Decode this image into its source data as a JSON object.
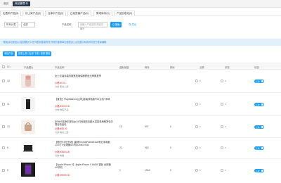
{
  "topbar": {
    "tabs": [
      {
        "label": "首页"
      },
      {
        "label": "商品管理 ⊗"
      }
    ]
  },
  "filter_tabs": [
    {
      "label": "出售中产品(5)",
      "count": 5
    },
    {
      "label": "待上架产品(0)",
      "count": 0
    },
    {
      "label": "仓库中产品(0)",
      "count": 0
    },
    {
      "label": "已经售馨产品(0)",
      "count": 0
    },
    {
      "label": "警戒库存(0)",
      "count": 0
    },
    {
      "label": "产品回收站(0)",
      "count": 0
    }
  ],
  "search": {
    "category_select": "所有分类",
    "type_select": "全部",
    "name_label": "产品名称",
    "name_placeholder": "请输入产品名称,关键字,编号",
    "search_button": "Q 搜索",
    "export_button": "导 导出"
  },
  "notice": "列表[活动按钮]以及[规格]可以在列表页直接修改 所有的金额单位都是[元] 点击图片和名称可进行批量编辑",
  "actions": {
    "add_button": "添加产品",
    "batch_button": "批量上架 / 批量 下架 / 批量 删除"
  },
  "table": {
    "headers": [
      "ID ↕",
      "产品图片",
      "产品名称",
      "虚拟销量",
      "库存",
      "排序",
      "点赞",
      "浏览",
      "状态"
    ],
    "rows": [
      {
        "id": "10",
        "name": "女士无袖泳装衣服宽松版保暖舒适无摩擦夏季",
        "price": "价格:¥0.01",
        "meta": "分类:美妆上装",
        "sales": "",
        "stock": "",
        "sort": "",
        "likes": "0",
        "views": "0",
        "status": "上架"
      },
      {
        "id": "11",
        "name": "【直营】PlayStation4(主机)套装体验版PS4主机+手柄",
        "price": "价格:¥3200.00",
        "meta": "分类:数码产品",
        "sales": "",
        "stock": "",
        "sort": "",
        "likes": "0",
        "views": "0",
        "status": "上架"
      },
      {
        "id": "13",
        "name": "BRMIS纯净手提包女士时尚潮流包款大容量单肩斜挎包手提包精品包",
        "price": "价格:¥88.00",
        "meta": "分类:美妆上装",
        "sales": "15",
        "stock": "997",
        "sort": "0",
        "likes": "0",
        "views": "0",
        "status": "上架"
      },
      {
        "id": "6",
        "name": "【限时9.9元专场】雷神ThundeRobot911M笔记本电脑13.3寸i7处理器4G内存256G SSD",
        "price": "价格:¥3500.00",
        "meta": "分类:电脑",
        "sales": "22",
        "stock": "983",
        "sort": "0",
        "likes": "0",
        "views": "0",
        "status": "上架"
      },
      {
        "id": "5",
        "name": "【Apple iPhone X】Apple iPhone X 64GB 银色 全网通4G手机",
        "price": "价格:¥6999.00",
        "meta": "",
        "sales": "1",
        "stock": "1963",
        "sort": "0",
        "likes": "0",
        "views": "0",
        "status": "上架"
      }
    ]
  },
  "colors": {
    "accent": "#1e9fff",
    "dark_tab": "#2d3a4b",
    "notice_bg": "#e1f1fb",
    "price": "#cc3333"
  }
}
